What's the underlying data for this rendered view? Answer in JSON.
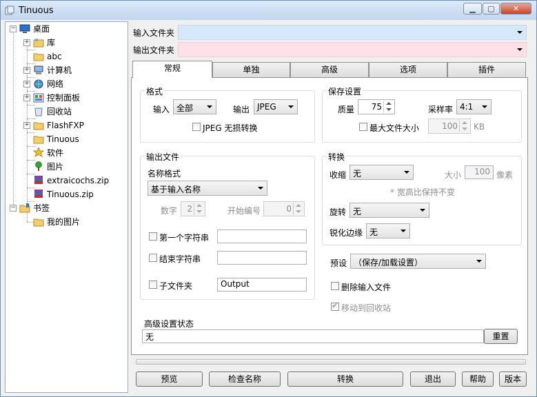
{
  "window": {
    "title": "Tinuous",
    "colors": {
      "input_folder_bg": "#d5e9fb",
      "output_folder_bg": "#fde0e8"
    }
  },
  "tree": {
    "items": [
      {
        "label": "桌面",
        "icon": "desktop-icon"
      },
      {
        "label": "库",
        "icon": "library-icon"
      },
      {
        "label": "abc",
        "icon": "folder-icon"
      },
      {
        "label": "计算机",
        "icon": "computer-icon"
      },
      {
        "label": "网络",
        "icon": "network-icon"
      },
      {
        "label": "控制面板",
        "icon": "control-panel-icon"
      },
      {
        "label": "回收站",
        "icon": "recycle-bin-icon"
      },
      {
        "label": "FlashFXP",
        "icon": "folder-icon"
      },
      {
        "label": "Tinuous",
        "icon": "folder-icon"
      },
      {
        "label": "软件",
        "icon": "star-icon"
      },
      {
        "label": "图片",
        "icon": "tree-icon"
      },
      {
        "label": "extraicochs.zip",
        "icon": "archive-icon"
      },
      {
        "label": "Tinuous.zip",
        "icon": "archive-icon"
      },
      {
        "label": "书签",
        "icon": "bookmark-folder-icon"
      },
      {
        "label": "我的图片",
        "icon": "folder-icon"
      }
    ]
  },
  "folders": {
    "input_label": "输入文件夹",
    "input_value": "",
    "output_label": "输出文件夹",
    "output_value": ""
  },
  "tabs": [
    "常规",
    "单独",
    "高级",
    "选项",
    "插件"
  ],
  "format": {
    "title": "格式",
    "input_label": "输入",
    "input_value": "全部",
    "output_label": "输出",
    "output_value": "JPEG",
    "lossless_label": "JPEG 无损转换"
  },
  "save": {
    "title": "保存设置",
    "quality_label": "质量",
    "quality_value": "75",
    "sampling_label": "采样率",
    "sampling_value": "4:1",
    "maxsize_label": "最大文件大小",
    "maxsize_value": "100",
    "maxsize_unit": "KB"
  },
  "output_file": {
    "title": "输出文件",
    "name_format_label": "名称格式",
    "name_format_value": "基于输入名称",
    "digits_label": "数字",
    "digits_value": "2",
    "start_label": "开始编号",
    "start_value": "0",
    "first_string_label": "第一个字符串",
    "first_string_value": "",
    "end_string_label": "结束字符串",
    "end_string_value": "",
    "subfolder_label": "子文件夹",
    "subfolder_value": "Output"
  },
  "convert": {
    "title": "转换",
    "resize_label": "收缩",
    "resize_value": "无",
    "size_label": "大小",
    "size_value": "100",
    "size_unit": "像素",
    "note": "* 宽高比保持不变",
    "rotate_label": "旋转",
    "rotate_value": "无",
    "sharpen_label": "锐化边缘",
    "sharpen_value": "无"
  },
  "preset": {
    "label": "预设",
    "value": "（保存/加载设置）"
  },
  "delete_input_label": "删除输入文件",
  "move_recycle_label": "移动到回收站",
  "advanced_status": {
    "label": "高级设置状态",
    "value": "无",
    "reset_label": "重置"
  },
  "bottom": {
    "preview": "预览",
    "check_name": "检查名称",
    "convert": "转换",
    "exit": "退出",
    "help": "帮助",
    "version": "版本"
  }
}
